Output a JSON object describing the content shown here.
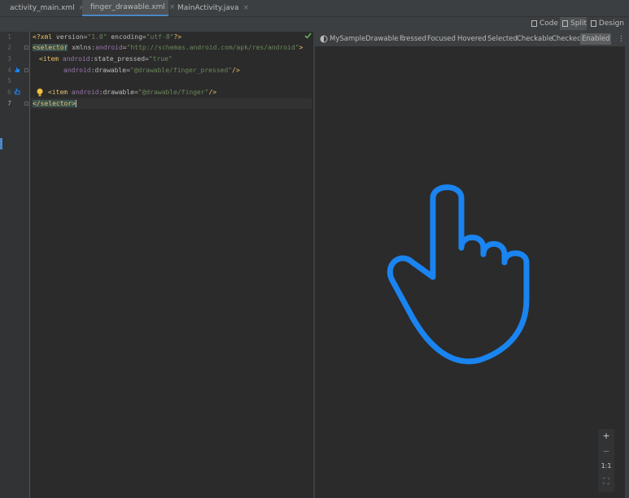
{
  "tabs": [
    {
      "label": "activity_main.xml",
      "icon": "xml-layout-icon",
      "icon_color": "#c26b3f"
    },
    {
      "label": "finger_drawable.xml",
      "icon": "xml-drawable-icon",
      "icon_color": "#c26b3f",
      "active": true
    },
    {
      "label": "MainActivity.java",
      "icon": "java-class-icon",
      "icon_color": "#3592c4"
    }
  ],
  "view_modes": {
    "code": "Code",
    "split": "Split",
    "design": "Design",
    "selected": "Split"
  },
  "editor": {
    "line_numbers": [
      "1",
      "2",
      "3",
      "4",
      "5",
      "6",
      "7"
    ],
    "current_line": "7",
    "lines": {
      "l1": {
        "a": "<?xml ",
        "b": "version",
        "c": "=",
        "d": "\"1.0\"",
        "e": " encoding",
        "f": "=",
        "g": "\"utf-8\"",
        "h": "?>"
      },
      "l2": {
        "a": "<",
        "b": "selector",
        "c": " xmlns:",
        "d": "android",
        "e": "=",
        "f": "\"http://schemas.android.com/apk/res/android\"",
        "g": ">"
      },
      "l3": {
        "a": "<item ",
        "b": "android",
        "c": ":state_pressed=",
        "d": "\"true\""
      },
      "l4": {
        "a": "android",
        "b": ":drawable=",
        "c": "\"@drawable/finger_pressed\"",
        "d": "/>"
      },
      "l6": {
        "a": "<item ",
        "b": "android",
        "c": ":drawable=",
        "d": "\"@drawable/finger\"",
        "e": "/>"
      },
      "l7": {
        "a": "</",
        "b": "selector",
        "c": ">"
      }
    }
  },
  "design_toolbar": {
    "drawable_selector": "MySampleDrawable",
    "states": [
      "Pressed",
      "Focused",
      "Hovered",
      "Selected",
      "Checkable",
      "Checked",
      "Enabled"
    ],
    "selected_state": "Enabled"
  },
  "preview": {
    "stroke_color": "#1a84f0"
  },
  "zoom_controls": {
    "zoom_in": "+",
    "zoom_out": "−",
    "actual_size": "1:1",
    "fit": "⛶"
  }
}
